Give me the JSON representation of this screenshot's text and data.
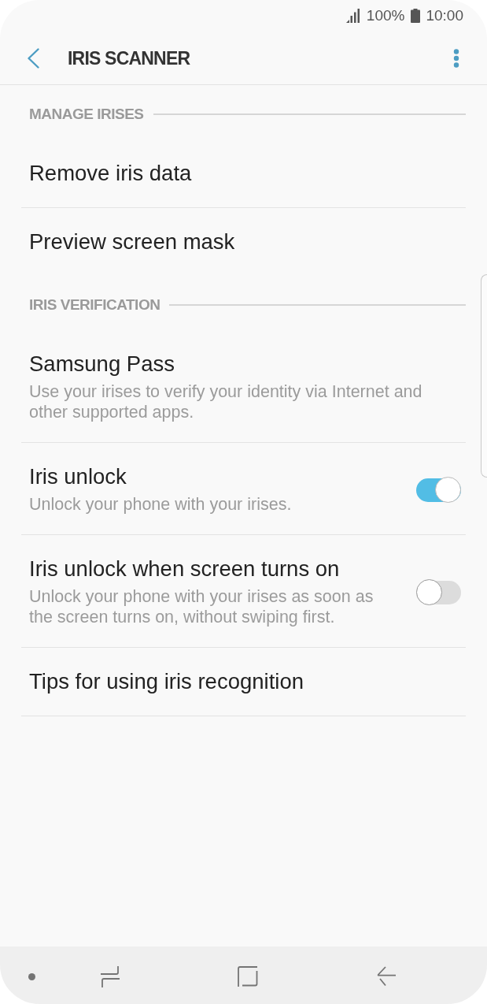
{
  "status_bar": {
    "battery_percent": "100%",
    "time": "10:00"
  },
  "header": {
    "title": "IRIS SCANNER"
  },
  "sections": [
    {
      "title": "MANAGE IRISES",
      "items": [
        {
          "kind": "link",
          "title": "Remove iris data"
        },
        {
          "kind": "link",
          "title": "Preview screen mask"
        }
      ]
    },
    {
      "title": "IRIS VERIFICATION",
      "items": [
        {
          "kind": "link",
          "title": "Samsung Pass",
          "subtitle": "Use your irises to verify your identity via Internet and other supported apps."
        },
        {
          "kind": "toggle",
          "title": "Iris unlock",
          "subtitle": "Unlock your phone with your irises.",
          "on": true
        },
        {
          "kind": "toggle",
          "title": "Iris unlock when screen turns on",
          "subtitle": "Unlock your phone with your irises as soon as the screen turns on, without swiping first.",
          "on": false
        },
        {
          "kind": "link",
          "title": "Tips for using iris recognition"
        }
      ]
    }
  ]
}
